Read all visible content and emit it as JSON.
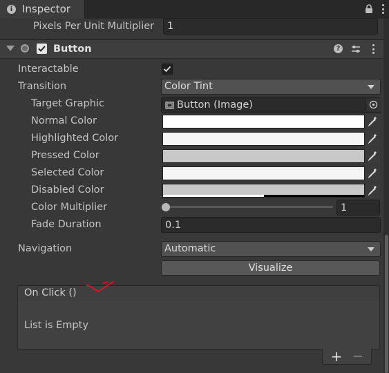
{
  "tab": {
    "title": "Inspector",
    "icon": "info-icon",
    "icon_glyph": "i"
  },
  "pixels_per_unit": {
    "label": "Pixels Per Unit Multiplier",
    "value": "1"
  },
  "component": {
    "title": "Button",
    "help_glyph": "?",
    "enabled": true
  },
  "properties": {
    "interactable": {
      "label": "Interactable",
      "checked": true
    },
    "transition": {
      "label": "Transition",
      "value": "Color Tint"
    },
    "target_graphic": {
      "label": "Target Graphic",
      "value": "Button (Image)"
    },
    "normal_color": {
      "label": "Normal Color",
      "color": "#ffffff"
    },
    "highlighted_color": {
      "label": "Highlighted Color",
      "color": "#f5f5f5"
    },
    "pressed_color": {
      "label": "Pressed Color",
      "color": "#c8c8c8"
    },
    "selected_color": {
      "label": "Selected Color",
      "color": "#f5f5f5"
    },
    "disabled_color": {
      "label": "Disabled Color",
      "color": "#c8c8c8",
      "alpha": 0.5
    },
    "color_multiplier": {
      "label": "Color Multiplier",
      "value": "1",
      "slider_fraction": 0
    },
    "fade_duration": {
      "label": "Fade Duration",
      "value": "0.1"
    },
    "navigation": {
      "label": "Navigation",
      "value": "Automatic"
    }
  },
  "visualize": {
    "label": "Visualize"
  },
  "on_click": {
    "title": "On Click ()",
    "empty_text": "List is Empty",
    "add_label": "+",
    "remove_label": "−"
  },
  "colors": {
    "background": "#383838",
    "field": "#2a2a2a",
    "annotation": "#e0141e"
  }
}
